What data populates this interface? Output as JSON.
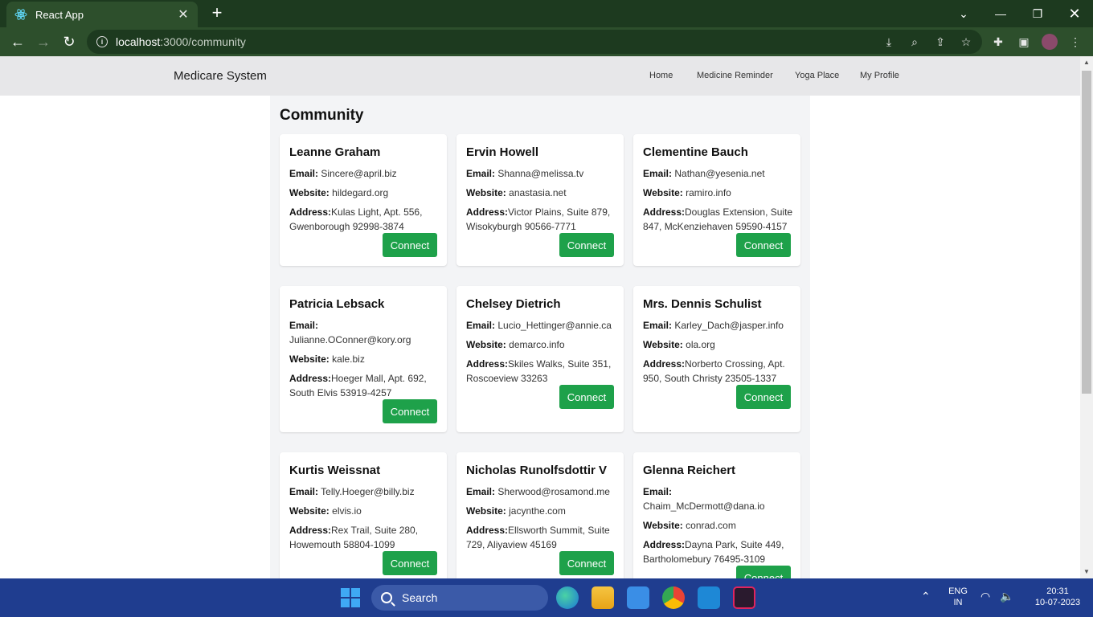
{
  "browser": {
    "tab_title": "React App",
    "new_tab": "+",
    "url_host": "localhost",
    "url_path": ":3000/community"
  },
  "app": {
    "brand": "Medicare System",
    "nav": [
      "Home",
      "Medicine Reminder",
      "Yoga Place",
      "My Profile"
    ],
    "heading": "Community",
    "connect_label": "Connect",
    "labels": {
      "email": "Email:",
      "website": "Website:",
      "address": "Address:"
    },
    "users": [
      {
        "name": "Leanne Graham",
        "email": "Sincere@april.biz",
        "website": "hildegard.org",
        "address": "Kulas Light, Apt. 556, Gwenborough 92998-3874"
      },
      {
        "name": "Ervin Howell",
        "email": "Shanna@melissa.tv",
        "website": "anastasia.net",
        "address": "Victor Plains, Suite 879, Wisokyburgh 90566-7771"
      },
      {
        "name": "Clementine Bauch",
        "email": "Nathan@yesenia.net",
        "website": "ramiro.info",
        "address": "Douglas Extension, Suite 847, McKenziehaven 59590-4157"
      },
      {
        "name": "Patricia Lebsack",
        "email": "Julianne.OConner@kory.org",
        "website": "kale.biz",
        "address": "Hoeger Mall, Apt. 692, South Elvis 53919-4257"
      },
      {
        "name": "Chelsey Dietrich",
        "email": "Lucio_Hettinger@annie.ca",
        "website": "demarco.info",
        "address": "Skiles Walks, Suite 351, Roscoeview 33263"
      },
      {
        "name": "Mrs. Dennis Schulist",
        "email": "Karley_Dach@jasper.info",
        "website": "ola.org",
        "address": "Norberto Crossing, Apt. 950, South Christy 23505-1337"
      },
      {
        "name": "Kurtis Weissnat",
        "email": "Telly.Hoeger@billy.biz",
        "website": "elvis.io",
        "address": "Rex Trail, Suite 280, Howemouth 58804-1099"
      },
      {
        "name": "Nicholas Runolfsdottir V",
        "email": "Sherwood@rosamond.me",
        "website": "jacynthe.com",
        "address": "Ellsworth Summit, Suite 729, Aliyaview 45169"
      },
      {
        "name": "Glenna Reichert",
        "email": "Chaim_McDermott@dana.io",
        "website": "conrad.com",
        "address": "Dayna Park, Suite 449, Bartholomebury 76495-3109"
      }
    ]
  },
  "taskbar": {
    "search_label": "Search",
    "lang_top": "ENG",
    "lang_bottom": "IN",
    "time": "20:31",
    "date": "10-07-2023"
  },
  "colors": {
    "connect": "#1ea14a",
    "chrome_frame": "#1d3a1f",
    "taskbar": "#1f3d8f"
  }
}
